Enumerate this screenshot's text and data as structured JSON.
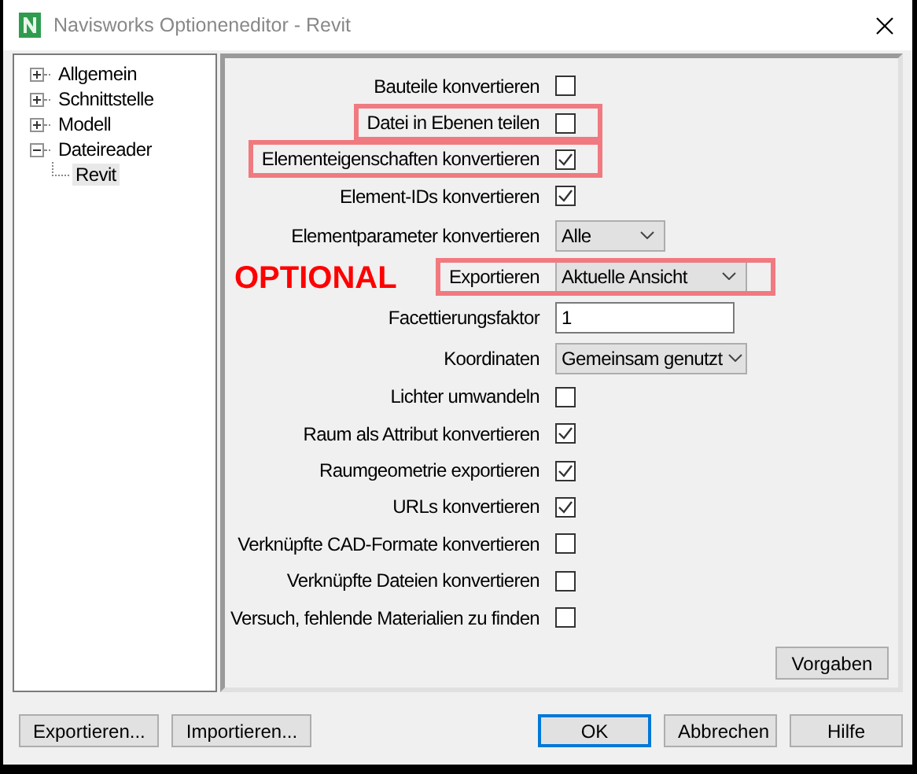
{
  "window": {
    "title": "Navisworks Optioneneditor - Revit"
  },
  "tree": [
    {
      "label": "Allgemein",
      "expanded": false,
      "selected": false
    },
    {
      "label": "Schnittstelle",
      "expanded": false,
      "selected": false
    },
    {
      "label": "Modell",
      "expanded": false,
      "selected": false
    },
    {
      "label": "Dateireader",
      "expanded": true,
      "selected": false,
      "children": [
        {
          "label": "Revit",
          "selected": true
        }
      ]
    }
  ],
  "options": [
    {
      "kind": "checkbox",
      "label": "Bauteile konvertieren",
      "checked": false,
      "highlighted": false
    },
    {
      "kind": "checkbox",
      "label": "Datei in Ebenen teilen",
      "checked": false,
      "highlighted": true
    },
    {
      "kind": "checkbox",
      "label": "Elementeigenschaften konvertieren",
      "checked": true,
      "highlighted": true
    },
    {
      "kind": "checkbox",
      "label": "Element-IDs konvertieren",
      "checked": true,
      "highlighted": false
    },
    {
      "kind": "dropdown",
      "label": "Elementparameter konvertieren",
      "value": "Alle",
      "highlighted": false
    },
    {
      "kind": "dropdown",
      "label": "Exportieren",
      "value": "Aktuelle Ansicht",
      "highlighted": true,
      "annotation": "OPTIONAL"
    },
    {
      "kind": "text",
      "label": "Facettierungsfaktor",
      "value": "1",
      "highlighted": false
    },
    {
      "kind": "dropdown",
      "label": "Koordinaten",
      "value": "Gemeinsam genutzt",
      "highlighted": false
    },
    {
      "kind": "checkbox",
      "label": "Lichter umwandeln",
      "checked": false,
      "highlighted": false
    },
    {
      "kind": "checkbox",
      "label": "Raum als Attribut konvertieren",
      "checked": true,
      "highlighted": false
    },
    {
      "kind": "checkbox",
      "label": "Raumgeometrie exportieren",
      "checked": true,
      "highlighted": false
    },
    {
      "kind": "checkbox",
      "label": "URLs konvertieren",
      "checked": true,
      "highlighted": false
    },
    {
      "kind": "checkbox",
      "label": "Verknüpfte CAD-Formate konvertieren",
      "checked": false,
      "highlighted": false
    },
    {
      "kind": "checkbox",
      "label": "Verknüpfte Dateien konvertieren",
      "checked": false,
      "highlighted": false
    },
    {
      "kind": "checkbox",
      "label": "Versuch, fehlende Materialien zu finden",
      "checked": false,
      "highlighted": false
    }
  ],
  "panel_button": "Vorgaben",
  "left_buttons": [
    "Exportieren...",
    "Importieren..."
  ],
  "right_buttons": [
    {
      "label": "OK",
      "default": true
    },
    {
      "label": "Abbrechen",
      "default": false
    },
    {
      "label": "Hilfe",
      "default": false
    }
  ]
}
